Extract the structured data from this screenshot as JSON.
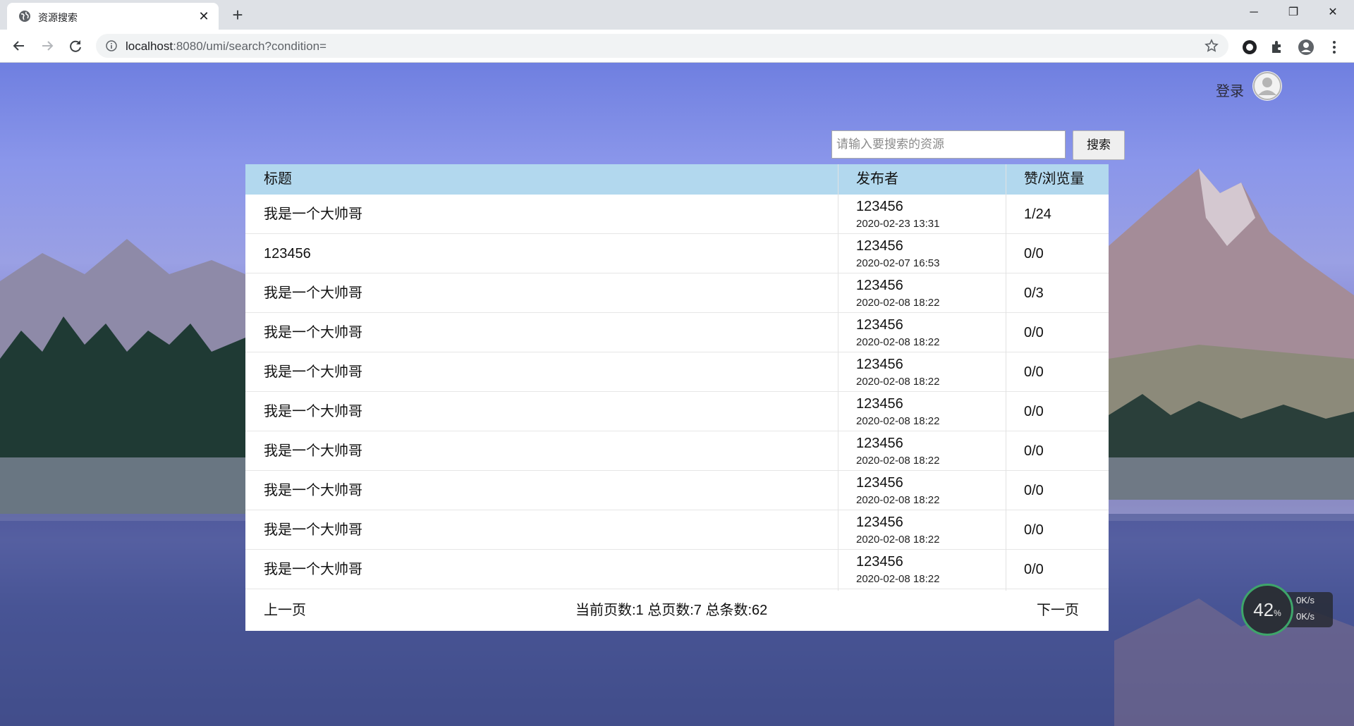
{
  "browser": {
    "tab_title": "资源搜索",
    "tab_close": "✕",
    "new_tab": "+",
    "url_host": "localhost",
    "url_rest": ":8080/umi/search?condition=",
    "window_controls": {
      "minimize": "─",
      "restore": "❐",
      "close": "✕"
    }
  },
  "header": {
    "login_label": "登录"
  },
  "search": {
    "placeholder": "请输入要搜索的资源",
    "value": "",
    "button_label": "搜索"
  },
  "table": {
    "columns": [
      "标题",
      "发布者",
      "赞/浏览量"
    ],
    "rows": [
      {
        "title": "我是一个大帅哥",
        "publisher": "123456",
        "date": "2020-02-23 13:31",
        "stats": "1/24"
      },
      {
        "title": "123456",
        "publisher": "123456",
        "date": "2020-02-07 16:53",
        "stats": "0/0"
      },
      {
        "title": "我是一个大帅哥",
        "publisher": "123456",
        "date": "2020-02-08 18:22",
        "stats": "0/3"
      },
      {
        "title": "我是一个大帅哥",
        "publisher": "123456",
        "date": "2020-02-08 18:22",
        "stats": "0/0"
      },
      {
        "title": "我是一个大帅哥",
        "publisher": "123456",
        "date": "2020-02-08 18:22",
        "stats": "0/0"
      },
      {
        "title": "我是一个大帅哥",
        "publisher": "123456",
        "date": "2020-02-08 18:22",
        "stats": "0/0"
      },
      {
        "title": "我是一个大帅哥",
        "publisher": "123456",
        "date": "2020-02-08 18:22",
        "stats": "0/0"
      },
      {
        "title": "我是一个大帅哥",
        "publisher": "123456",
        "date": "2020-02-08 18:22",
        "stats": "0/0"
      },
      {
        "title": "我是一个大帅哥",
        "publisher": "123456",
        "date": "2020-02-08 18:22",
        "stats": "0/0"
      },
      {
        "title": "我是一个大帅哥",
        "publisher": "123456",
        "date": "2020-02-08 18:22",
        "stats": "0/0"
      }
    ]
  },
  "pager": {
    "prev_label": "上一页",
    "info": "当前页数:1 总页数:7 总条数:62",
    "next_label": "下一页"
  },
  "net_widget": {
    "percent": "42",
    "percent_unit": "%",
    "upload": "0K/s",
    "download": "0K/s"
  },
  "colors": {
    "table_header": "#b2d8ee",
    "accent_ring": "#3ea56a"
  }
}
